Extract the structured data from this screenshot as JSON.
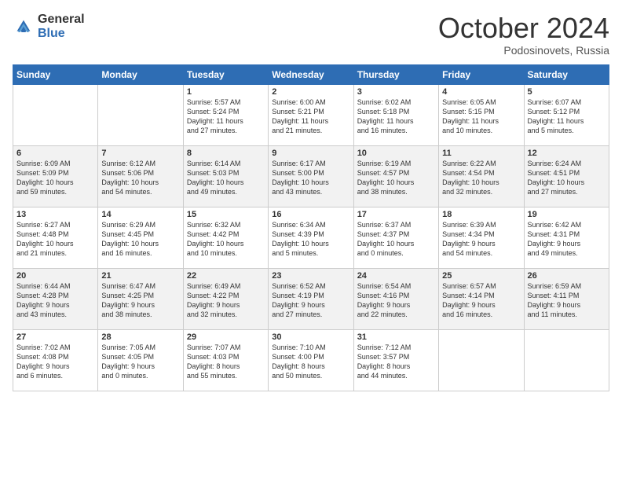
{
  "header": {
    "logo": {
      "general": "General",
      "blue": "Blue"
    },
    "title": "October 2024",
    "subtitle": "Podosinovets, Russia"
  },
  "weekdays": [
    "Sunday",
    "Monday",
    "Tuesday",
    "Wednesday",
    "Thursday",
    "Friday",
    "Saturday"
  ],
  "weeks": [
    [
      {
        "day": "",
        "info": ""
      },
      {
        "day": "",
        "info": ""
      },
      {
        "day": "1",
        "info": "Sunrise: 5:57 AM\nSunset: 5:24 PM\nDaylight: 11 hours\nand 27 minutes."
      },
      {
        "day": "2",
        "info": "Sunrise: 6:00 AM\nSunset: 5:21 PM\nDaylight: 11 hours\nand 21 minutes."
      },
      {
        "day": "3",
        "info": "Sunrise: 6:02 AM\nSunset: 5:18 PM\nDaylight: 11 hours\nand 16 minutes."
      },
      {
        "day": "4",
        "info": "Sunrise: 6:05 AM\nSunset: 5:15 PM\nDaylight: 11 hours\nand 10 minutes."
      },
      {
        "day": "5",
        "info": "Sunrise: 6:07 AM\nSunset: 5:12 PM\nDaylight: 11 hours\nand 5 minutes."
      }
    ],
    [
      {
        "day": "6",
        "info": "Sunrise: 6:09 AM\nSunset: 5:09 PM\nDaylight: 10 hours\nand 59 minutes."
      },
      {
        "day": "7",
        "info": "Sunrise: 6:12 AM\nSunset: 5:06 PM\nDaylight: 10 hours\nand 54 minutes."
      },
      {
        "day": "8",
        "info": "Sunrise: 6:14 AM\nSunset: 5:03 PM\nDaylight: 10 hours\nand 49 minutes."
      },
      {
        "day": "9",
        "info": "Sunrise: 6:17 AM\nSunset: 5:00 PM\nDaylight: 10 hours\nand 43 minutes."
      },
      {
        "day": "10",
        "info": "Sunrise: 6:19 AM\nSunset: 4:57 PM\nDaylight: 10 hours\nand 38 minutes."
      },
      {
        "day": "11",
        "info": "Sunrise: 6:22 AM\nSunset: 4:54 PM\nDaylight: 10 hours\nand 32 minutes."
      },
      {
        "day": "12",
        "info": "Sunrise: 6:24 AM\nSunset: 4:51 PM\nDaylight: 10 hours\nand 27 minutes."
      }
    ],
    [
      {
        "day": "13",
        "info": "Sunrise: 6:27 AM\nSunset: 4:48 PM\nDaylight: 10 hours\nand 21 minutes."
      },
      {
        "day": "14",
        "info": "Sunrise: 6:29 AM\nSunset: 4:45 PM\nDaylight: 10 hours\nand 16 minutes."
      },
      {
        "day": "15",
        "info": "Sunrise: 6:32 AM\nSunset: 4:42 PM\nDaylight: 10 hours\nand 10 minutes."
      },
      {
        "day": "16",
        "info": "Sunrise: 6:34 AM\nSunset: 4:39 PM\nDaylight: 10 hours\nand 5 minutes."
      },
      {
        "day": "17",
        "info": "Sunrise: 6:37 AM\nSunset: 4:37 PM\nDaylight: 10 hours\nand 0 minutes."
      },
      {
        "day": "18",
        "info": "Sunrise: 6:39 AM\nSunset: 4:34 PM\nDaylight: 9 hours\nand 54 minutes."
      },
      {
        "day": "19",
        "info": "Sunrise: 6:42 AM\nSunset: 4:31 PM\nDaylight: 9 hours\nand 49 minutes."
      }
    ],
    [
      {
        "day": "20",
        "info": "Sunrise: 6:44 AM\nSunset: 4:28 PM\nDaylight: 9 hours\nand 43 minutes."
      },
      {
        "day": "21",
        "info": "Sunrise: 6:47 AM\nSunset: 4:25 PM\nDaylight: 9 hours\nand 38 minutes."
      },
      {
        "day": "22",
        "info": "Sunrise: 6:49 AM\nSunset: 4:22 PM\nDaylight: 9 hours\nand 32 minutes."
      },
      {
        "day": "23",
        "info": "Sunrise: 6:52 AM\nSunset: 4:19 PM\nDaylight: 9 hours\nand 27 minutes."
      },
      {
        "day": "24",
        "info": "Sunrise: 6:54 AM\nSunset: 4:16 PM\nDaylight: 9 hours\nand 22 minutes."
      },
      {
        "day": "25",
        "info": "Sunrise: 6:57 AM\nSunset: 4:14 PM\nDaylight: 9 hours\nand 16 minutes."
      },
      {
        "day": "26",
        "info": "Sunrise: 6:59 AM\nSunset: 4:11 PM\nDaylight: 9 hours\nand 11 minutes."
      }
    ],
    [
      {
        "day": "27",
        "info": "Sunrise: 7:02 AM\nSunset: 4:08 PM\nDaylight: 9 hours\nand 6 minutes."
      },
      {
        "day": "28",
        "info": "Sunrise: 7:05 AM\nSunset: 4:05 PM\nDaylight: 9 hours\nand 0 minutes."
      },
      {
        "day": "29",
        "info": "Sunrise: 7:07 AM\nSunset: 4:03 PM\nDaylight: 8 hours\nand 55 minutes."
      },
      {
        "day": "30",
        "info": "Sunrise: 7:10 AM\nSunset: 4:00 PM\nDaylight: 8 hours\nand 50 minutes."
      },
      {
        "day": "31",
        "info": "Sunrise: 7:12 AM\nSunset: 3:57 PM\nDaylight: 8 hours\nand 44 minutes."
      },
      {
        "day": "",
        "info": ""
      },
      {
        "day": "",
        "info": ""
      }
    ]
  ]
}
